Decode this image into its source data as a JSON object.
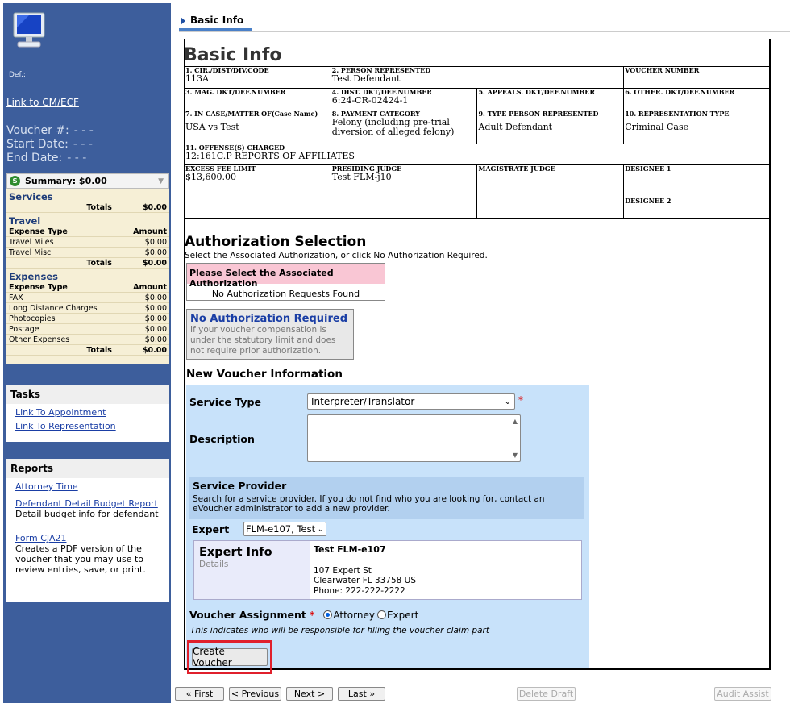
{
  "sidebar": {
    "def_label": "Def.:",
    "cmecf_link": "Link to CM/ECF",
    "voucher_label": "Voucher #:",
    "voucher_value": "- - -",
    "start_label": "Start Date:",
    "start_value": "- - -",
    "end_label": "End Date:",
    "end_value": "- - -",
    "summary": {
      "title": "Summary: $0.00",
      "services": {
        "title": "Services",
        "totals_label": "Totals",
        "totals_value": "$0.00"
      },
      "travel": {
        "title": "Travel",
        "col1": "Expense Type",
        "col2": "Amount",
        "rows": [
          {
            "name": "Travel Miles",
            "amount": "$0.00"
          },
          {
            "name": "Travel Misc",
            "amount": "$0.00"
          }
        ],
        "totals_label": "Totals",
        "totals_value": "$0.00"
      },
      "expenses": {
        "title": "Expenses",
        "col1": "Expense Type",
        "col2": "Amount",
        "rows": [
          {
            "name": "FAX",
            "amount": "$0.00"
          },
          {
            "name": "Long Distance Charges",
            "amount": "$0.00"
          },
          {
            "name": "Photocopies",
            "amount": "$0.00"
          },
          {
            "name": "Postage",
            "amount": "$0.00"
          },
          {
            "name": "Other Expenses",
            "amount": "$0.00"
          }
        ],
        "totals_label": "Totals",
        "totals_value": "$0.00"
      }
    },
    "tasks": {
      "title": "Tasks",
      "links": [
        "Link To Appointment",
        "Link To Representation"
      ]
    },
    "reports": {
      "title": "Reports",
      "attorney_time": "Attorney Time",
      "budget_link": "Defendant Detail Budget Report",
      "budget_desc": "Detail budget info for defendant",
      "cja21_link": "Form CJA21",
      "cja21_desc": "Creates a PDF version of the voucher that you may use to review entries, save, or print."
    }
  },
  "tab": {
    "label": "Basic Info"
  },
  "page_title": "Basic Info",
  "form": {
    "cir_label": "1. CIR./DIST/DIV.CODE",
    "cir_value": "113A",
    "person_label": "2. PERSON REPRESENTED",
    "person_value": "Test Defendant",
    "voucher_label": "VOUCHER NUMBER",
    "voucher_value": "",
    "mag_label": "3. MAG. DKT/DEF.NUMBER",
    "mag_value": "",
    "dist_label": "4. DIST. DKT/DEF.NUMBER",
    "dist_value": "6:24-CR-02424-1",
    "appeals_label": "5. APPEALS. DKT/DEF.NUMBER",
    "appeals_value": "",
    "other_label": "6. OTHER. DKT/DEF.NUMBER",
    "other_value": "",
    "case_label": "7. IN CASE/MATTER OF(Case Name)",
    "case_value": "USA vs Test",
    "payment_label": "8. PAYMENT CATEGORY",
    "payment_value": "Felony (including pre-trial diversion of alleged felony)",
    "type_label": "9. TYPE PERSON REPRESENTED",
    "type_value": "Adult Defendant",
    "rep_label": "10. REPRESENTATION TYPE",
    "rep_value": "Criminal Case",
    "offense_label": "11. OFFENSE(S) CHARGED",
    "offense_value": "12:161C.P REPORTS OF AFFILIATES",
    "excess_label": "EXCESS FEE LIMIT",
    "excess_value": "$13,600.00",
    "judge_label": "PRESIDING JUDGE",
    "judge_value": "Test FLM-j10",
    "magistrate_label": "MAGISTRATE JUDGE",
    "magistrate_value": "",
    "designee1_label": "DESIGNEE 1",
    "designee2_label": "DESIGNEE 2"
  },
  "auth": {
    "title": "Authorization Selection",
    "subtitle": "Select the Associated Authorization, or click No Authorization Required.",
    "header": "Please Select the Associated Authorization",
    "none": "No Authorization Requests Found",
    "no_auth_link": "No Authorization Required",
    "no_auth_desc": "If your voucher compensation is under the statutory limit and does not require prior authorization."
  },
  "new_voucher": {
    "title": "New Voucher Information",
    "service_type_label": "Service Type",
    "service_type_value": "Interpreter/Translator",
    "description_label": "Description",
    "description_value": "",
    "sp_title": "Service Provider",
    "sp_desc": "Search for a service provider. If you do not find who you are looking for, contact an eVoucher administrator to add a new provider.",
    "expert_label": "Expert",
    "expert_value": "FLM-e107, Test",
    "expert_info_title": "Expert Info",
    "expert_info_sub": "Details",
    "expert_name": "Test FLM-e107",
    "expert_addr1": "107 Expert St",
    "expert_addr2": "Clearwater FL 33758 US",
    "expert_phone": "Phone: 222-222-2222",
    "assignment_label": "Voucher Assignment",
    "opt_attorney": "Attorney",
    "opt_expert": "Expert",
    "assignment_note": "This indicates who will be responsible for filling the voucher claim part",
    "create_button": "Create Voucher"
  },
  "nav": {
    "first": "« First",
    "previous": "< Previous",
    "next": "Next >",
    "last": "Last »",
    "delete": "Delete Draft",
    "audit": "Audit Assist"
  },
  "colors": {
    "sidebar": "#3d5e9c",
    "highlight": "#e0202c",
    "blue_panel": "#c8e2fa"
  }
}
